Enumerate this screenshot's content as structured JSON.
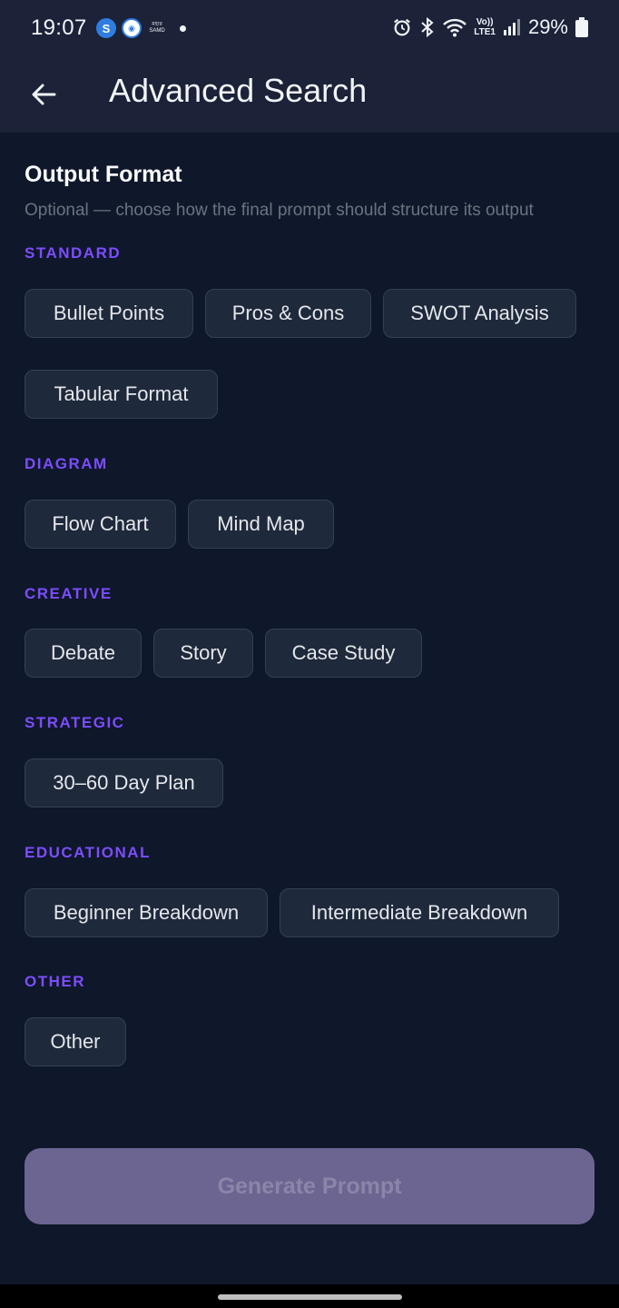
{
  "status_bar": {
    "time": "19:07",
    "mini_label_top": "মহার",
    "mini_label_bottom": "SAMD",
    "battery": "29%",
    "volte_label_top": "Vo))",
    "volte_label_bottom": "LTE1"
  },
  "app_bar": {
    "title": "Advanced Search"
  },
  "section": {
    "title": "Output Format",
    "subtitle": "Optional — choose how the final prompt should structure its output"
  },
  "groups": {
    "standard": {
      "label": "STANDARD",
      "chips": [
        "Bullet Points",
        "Pros & Cons",
        "SWOT Analysis",
        "Tabular Format"
      ]
    },
    "diagram": {
      "label": "DIAGRAM",
      "chips": [
        "Flow Chart",
        "Mind Map"
      ]
    },
    "creative": {
      "label": "CREATIVE",
      "chips": [
        "Debate",
        "Story",
        "Case Study"
      ]
    },
    "strategic": {
      "label": "STRATEGIC",
      "chips": [
        "30–60 Day Plan"
      ]
    },
    "educational": {
      "label": "EDUCATIONAL",
      "chips": [
        "Beginner Breakdown",
        "Intermediate Breakdown"
      ]
    },
    "other": {
      "label": "OTHER",
      "chips": [
        "Other"
      ]
    }
  },
  "actions": {
    "generate_label": "Generate Prompt"
  },
  "colors": {
    "background": "#0f172a",
    "header": "#1c2238",
    "accent_label": "#7c4dff",
    "chip_bg": "#1e293b",
    "chip_border": "#334155",
    "button_disabled": "#6c6592"
  },
  "icons": {
    "back": "arrow-left-icon",
    "alarm": "alarm-icon",
    "bluetooth": "bluetooth-icon",
    "wifi": "wifi-icon",
    "signal": "signal-icon",
    "battery": "battery-icon"
  }
}
